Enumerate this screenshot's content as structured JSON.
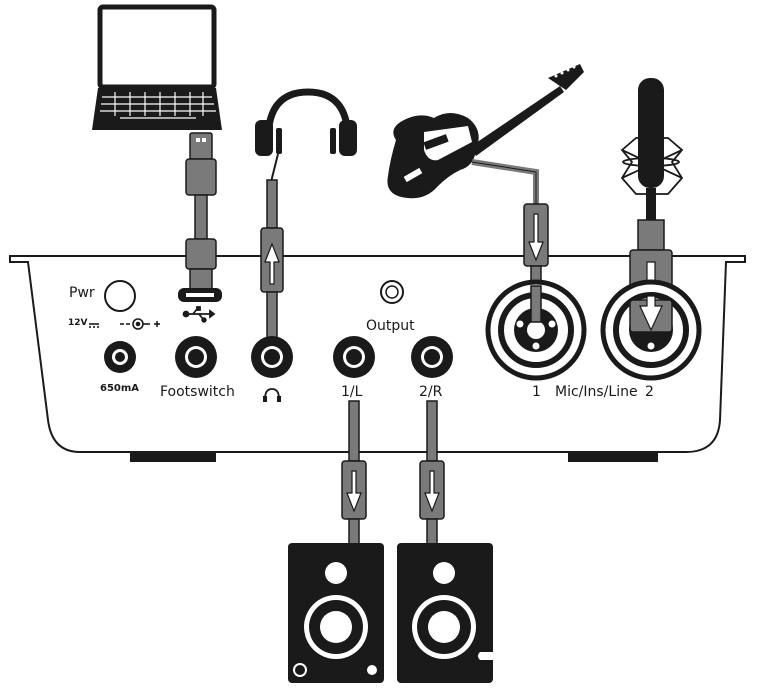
{
  "labels": {
    "pwr": "Pwr",
    "dc_spec": "12V",
    "current": "650mA",
    "footswitch": "Footswitch",
    "output": "Output",
    "out_1l": "1/L",
    "out_2r": "2/R",
    "mic_1": "1",
    "mic_ins_line": "Mic/Ins/Line",
    "mic_2": "2"
  },
  "icons": [
    "laptop-icon",
    "usb-cable-icon",
    "usb-symbol-icon",
    "headphones-icon",
    "headphone-symbol-icon",
    "electric-guitar-icon",
    "condenser-microphone-icon",
    "studio-monitor-icon",
    "dc-polarity-icon",
    "signal-flow-arrow-icon"
  ],
  "colors": {
    "ink": "#1a1a1a",
    "cable": "#7a7a7a",
    "background": "#ffffff"
  }
}
